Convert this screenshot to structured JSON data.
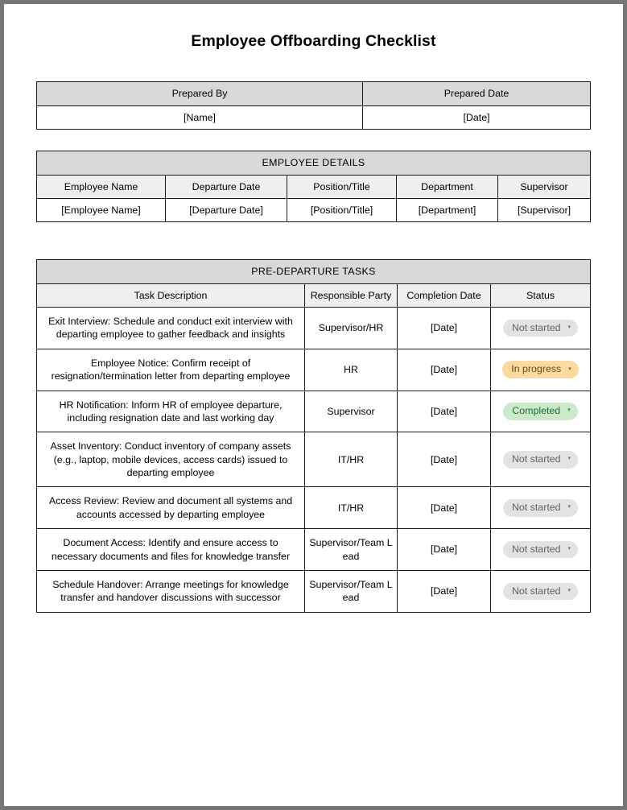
{
  "document": {
    "title": "Employee Offboarding Checklist"
  },
  "prepared": {
    "headers": [
      "Prepared By",
      "Prepared Date"
    ],
    "values": [
      "[Name]",
      "[Date]"
    ]
  },
  "employee_details": {
    "band_title": "EMPLOYEE DETAILS",
    "headers": [
      "Employee Name",
      "Departure Date",
      "Position/Title",
      "Department",
      "Supervisor"
    ],
    "values": [
      "[Employee Name]",
      "[Departure Date]",
      "[Position/Title]",
      "[Department]",
      "[Supervisor]"
    ]
  },
  "pre_departure": {
    "band_title": "PRE-DEPARTURE TASKS",
    "headers": [
      "Task Description",
      "Responsible Party",
      "Completion Date",
      "Status"
    ],
    "status_options": [
      "Not started",
      "In progress",
      "Completed"
    ],
    "status_colors": {
      "not_started_bg": "#e3e3e3",
      "not_started_fg": "#5f6368",
      "in_progress_bg": "#fcd9a0",
      "in_progress_fg": "#6b4a12",
      "completed_bg": "#cbeaca",
      "completed_fg": "#1e6b33"
    },
    "caret_glyph": "▾",
    "rows": [
      {
        "task": "Exit Interview: Schedule and conduct exit interview with departing employee to gather feedback and insights",
        "party": "Supervisor/HR",
        "date": "[Date]",
        "status": "Not started"
      },
      {
        "task": "Employee Notice: Confirm receipt of resignation/termination letter from departing employee",
        "party": "HR",
        "date": "[Date]",
        "status": "In progress"
      },
      {
        "task": "HR Notification: Inform HR of employee departure, including resignation date and last working day",
        "party": "Supervisor",
        "date": "[Date]",
        "status": "Completed"
      },
      {
        "task": "Asset Inventory: Conduct inventory of company assets (e.g., laptop, mobile devices, access cards) issued to departing employee",
        "party": "IT/HR",
        "date": "[Date]",
        "status": "Not started"
      },
      {
        "task": "Access Review: Review and document all systems and accounts accessed by departing employee",
        "party": "IT/HR",
        "date": "[Date]",
        "status": "Not started"
      },
      {
        "task": "Document Access: Identify and ensure access to necessary documents and files for knowledge transfer",
        "party": "Supervisor/Team Lead",
        "date": "[Date]",
        "status": "Not started"
      },
      {
        "task": "Schedule Handover: Arrange meetings for knowledge transfer and handover discussions with successor",
        "party": "Supervisor/Team Lead",
        "date": "[Date]",
        "status": "Not started"
      }
    ]
  }
}
